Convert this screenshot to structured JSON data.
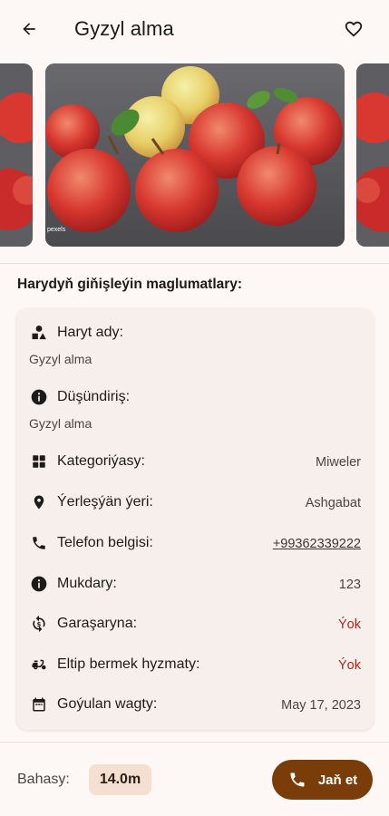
{
  "app_bar": {
    "title": "Gyzyl alma",
    "back_icon": "arrow-left-icon",
    "favorite_icon": "heart-outline-icon"
  },
  "gallery": {
    "images": [
      "apple-photo",
      "apple-photo",
      "apple-photo"
    ],
    "watermark": "pexels"
  },
  "details": {
    "heading": "Harydyň giňişleýin maglumatlary:",
    "name": {
      "label": "Haryt ady:",
      "value": "Gyzyl alma",
      "icon": "shapes-icon"
    },
    "description": {
      "label": "Düşündiriş:",
      "value": "Gyzyl alma",
      "icon": "info-icon"
    },
    "rows": [
      {
        "label": "Kategoriýasy:",
        "value": "Miweler",
        "icon": "grid-icon"
      },
      {
        "label": "Ýerleşýän ýeri:",
        "value": "Ashgabat",
        "icon": "location-pin-icon"
      },
      {
        "label": "Telefon belgisi:",
        "value": "+99362339222",
        "icon": "phone-icon"
      },
      {
        "label": "Mukdary:",
        "value": "123",
        "icon": "info-icon"
      },
      {
        "label": "Garaşaryna:",
        "value": "Ýok",
        "icon": "exchange-icon"
      },
      {
        "label": "Eltip bermek hyzmaty:",
        "value": "Ýok",
        "icon": "delivery-icon"
      },
      {
        "label": "Goýulan wagty:",
        "value": "May 17, 2023",
        "icon": "calendar-icon"
      }
    ]
  },
  "footer": {
    "price_label": "Bahasy:",
    "price": "14.0m",
    "call_label": "Jaň et",
    "call_icon": "phone-icon"
  },
  "colors": {
    "accent": "#7a3d0a",
    "negative": "#b3261e",
    "card": "#f6efec",
    "price_chip": "#f5dfd0"
  }
}
